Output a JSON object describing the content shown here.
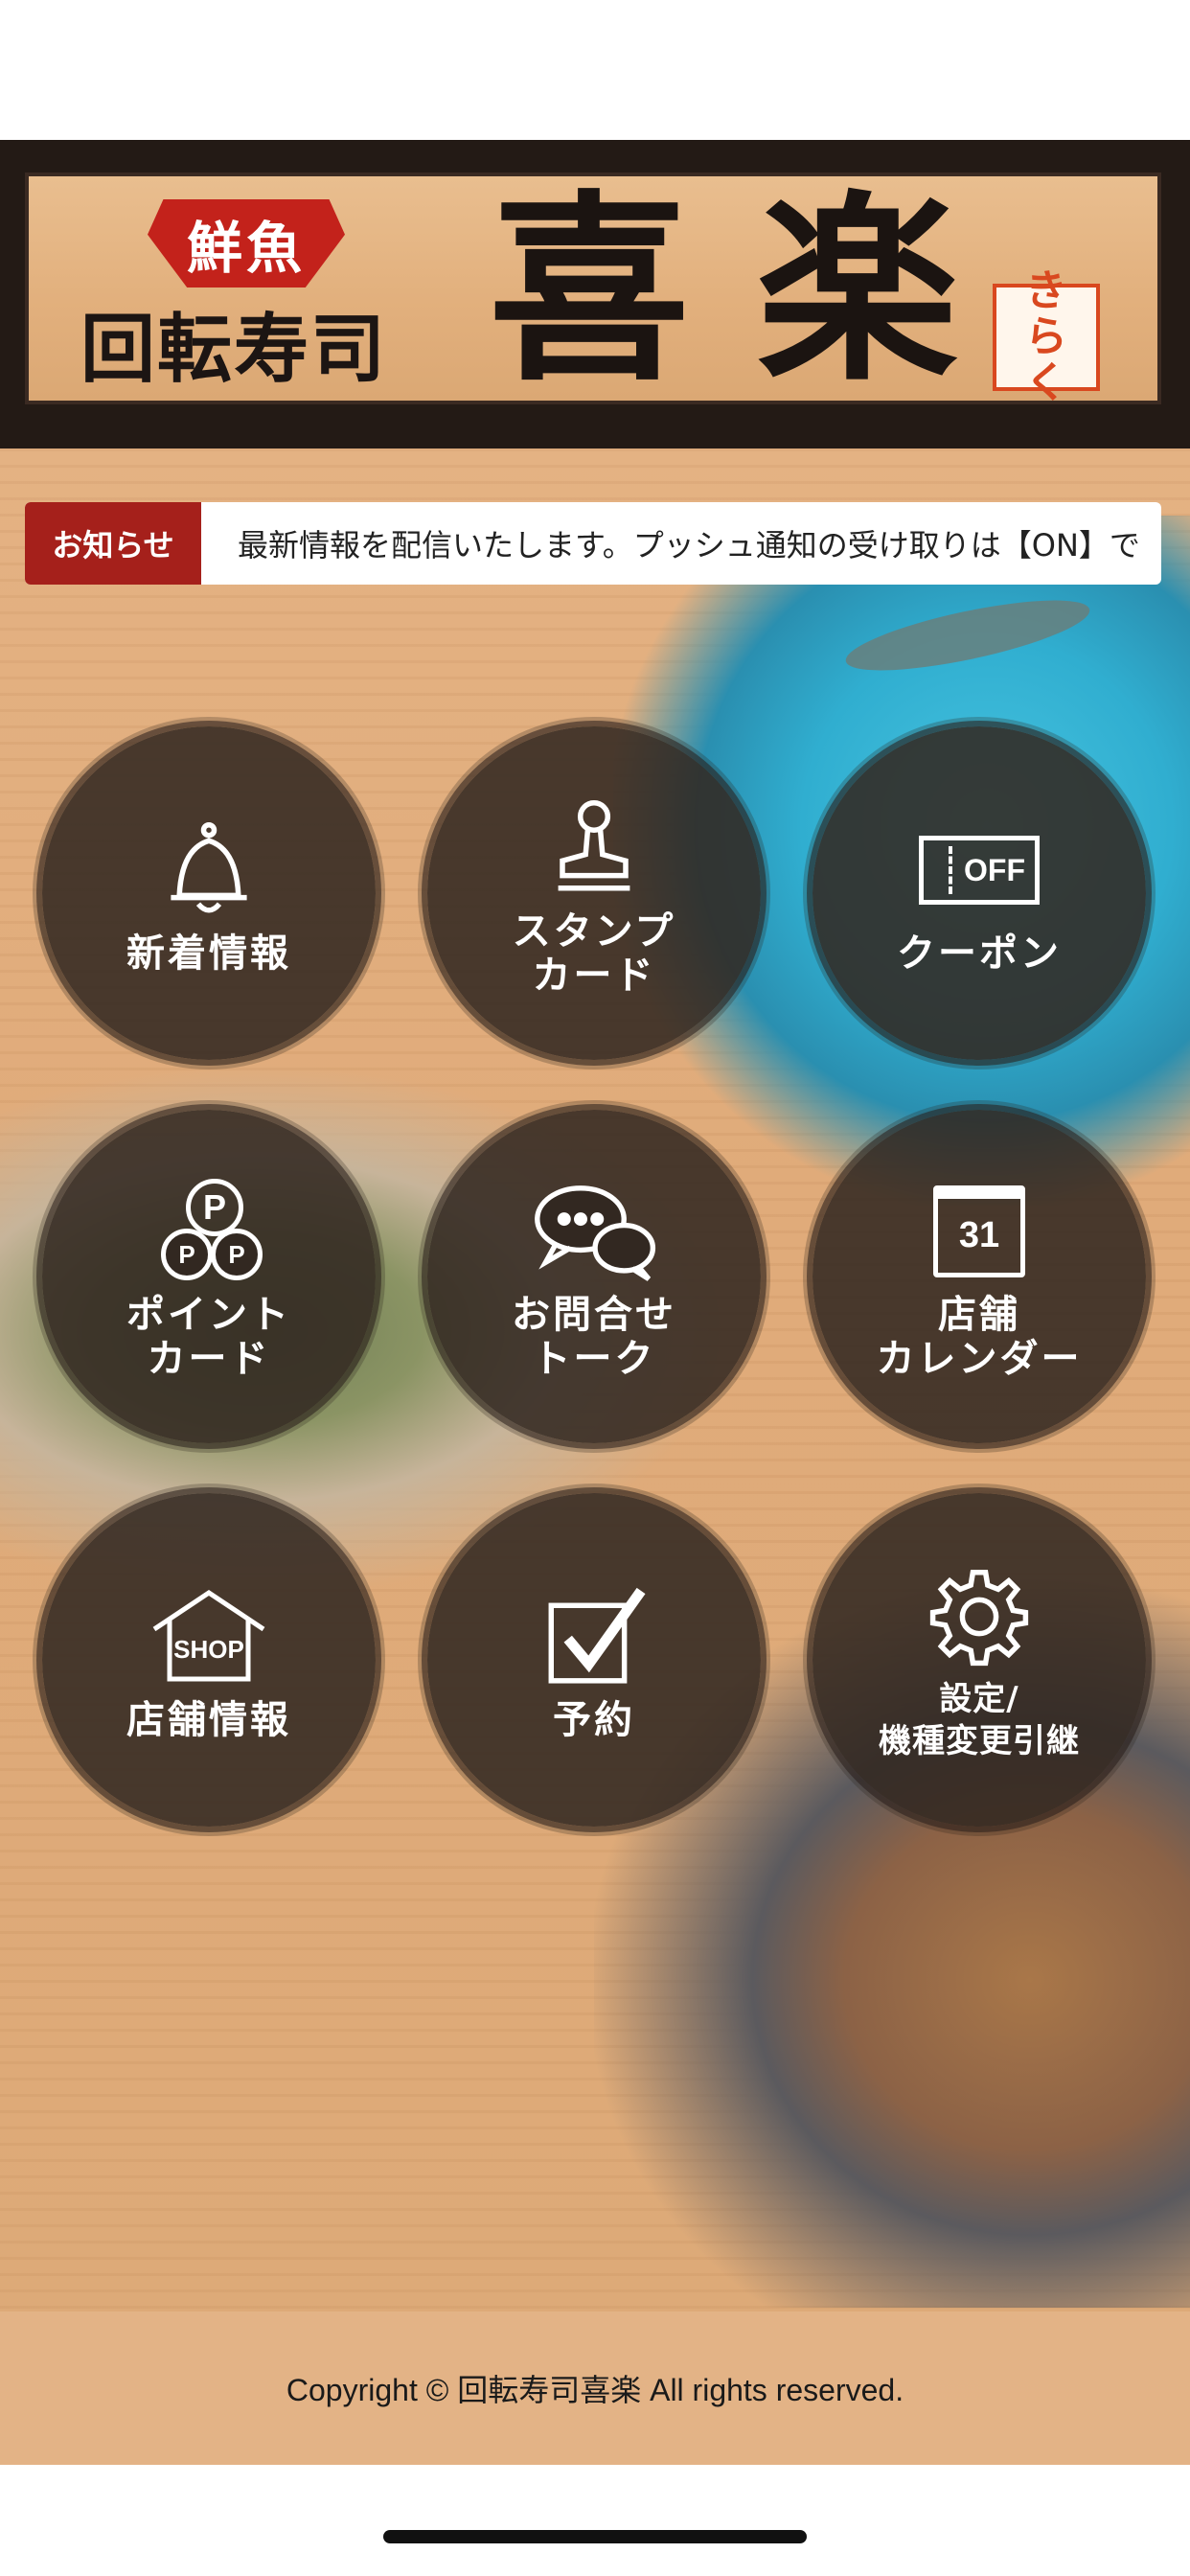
{
  "header": {
    "fresh_label": "鮮魚",
    "shop_type": "回転寿司",
    "brand_name": "喜楽",
    "kana_logo": "きらく"
  },
  "news": {
    "label": "お知らせ",
    "text": "最新情報を配信いたします。プッシュ通知の受け取りは【ON】で"
  },
  "menu": [
    {
      "label": "新着情報",
      "icon": "bell-icon"
    },
    {
      "label": "スタンプ\nカード",
      "icon": "stamp-icon"
    },
    {
      "label": "クーポン",
      "icon": "coupon-icon",
      "icon_text": "OFF"
    },
    {
      "label": "ポイント\nカード",
      "icon": "points-icon",
      "icon_text": "P"
    },
    {
      "label": "お問合せ\nトーク",
      "icon": "chat-icon"
    },
    {
      "label": "店舗\nカレンダー",
      "icon": "calendar-icon",
      "icon_text": "31"
    },
    {
      "label": "店舗情報",
      "icon": "shop-icon",
      "icon_text": "SHOP"
    },
    {
      "label": "予約",
      "icon": "checkbox-icon"
    },
    {
      "label": "設定/\n機種変更引継",
      "icon": "gear-icon"
    }
  ],
  "footer": {
    "copyright": "Copyright © 回転寿司喜楽 All rights reserved."
  }
}
